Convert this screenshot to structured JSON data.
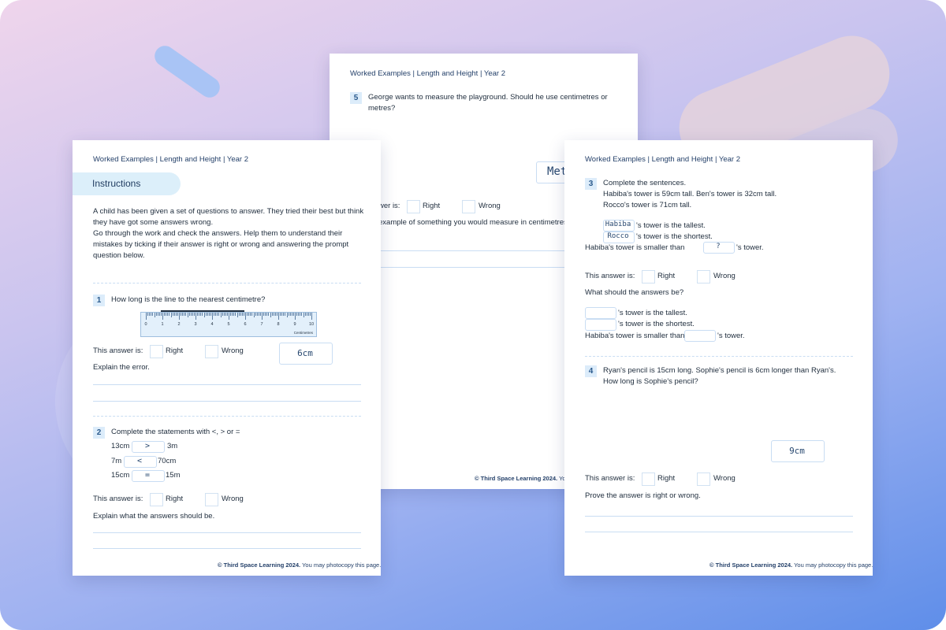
{
  "header": "Worked Examples | Length and Height | Year 2",
  "footer": {
    "bold": "© Third Space Learning 2024.",
    "rest": " You may photocopy this page.",
    "partial": " You m"
  },
  "labels": {
    "this_answer": "This answer is:",
    "right": "Right",
    "wrong": "Wrong"
  },
  "left_sheet": {
    "instructions_tab": "Instructions",
    "instructions": [
      "A child has been given a set of questions to answer. They tried their best but think",
      "they have got some answers wrong.",
      "Go through the work and check the answers. Help them to understand their",
      "mistakes by ticking if their answer is right or wrong and answering the prompt",
      "question below."
    ],
    "q1": {
      "num": "1",
      "text": "How long is the line to the nearest centimetre?",
      "answer": "6cm",
      "explain": "Explain the error.",
      "ruler_numbers": [
        "0",
        "1",
        "2",
        "3",
        "4",
        "5",
        "6",
        "7",
        "8",
        "9",
        "10"
      ],
      "ruler_caption": "Centimetres"
    },
    "q2": {
      "num": "2",
      "text": "Complete the statements with <, > or =",
      "rows": [
        {
          "left": "13cm",
          "symbol": ">",
          "right": "3m"
        },
        {
          "left": "7m",
          "symbol": "<",
          "right": "70cm"
        },
        {
          "left": "15cm",
          "symbol": "=",
          "right": "15m"
        }
      ],
      "explain": "Explain what the answers should be."
    }
  },
  "middle_sheet": {
    "q5": {
      "num": "5",
      "text1": "George wants to measure the playground. Should he use centimetres or",
      "text2": "metres?",
      "answer": "Met"
    },
    "partial_this_answer": "wer is:",
    "partial_example": "example of something you would measure in centimetres. E"
  },
  "right_sheet": {
    "q3": {
      "num": "3",
      "title": "Complete the sentences.",
      "line1": "Habiba's tower is 59cm tall. Ben's tower is 32cm tall.",
      "line2": "Rocco's tower is 71cm tall.",
      "ans_tallest": "Habiba",
      "ans_shortest": "Rocco",
      "ans_smaller": "?",
      "tallest": "'s tower is the tallest.",
      "shortest": "'s tower is the shortest.",
      "smaller_prefix": "Habiba's tower is smaller than",
      "smaller_suffix": "'s tower.",
      "what_should": "What should the answers be?"
    },
    "q4": {
      "num": "4",
      "line1": "Ryan's pencil is 15cm long. Sophie's pencil is 6cm longer than Ryan's.",
      "line2": "How long is Sophie's pencil?",
      "answer": "9cm",
      "prove": "Prove the answer is right or wrong."
    }
  }
}
